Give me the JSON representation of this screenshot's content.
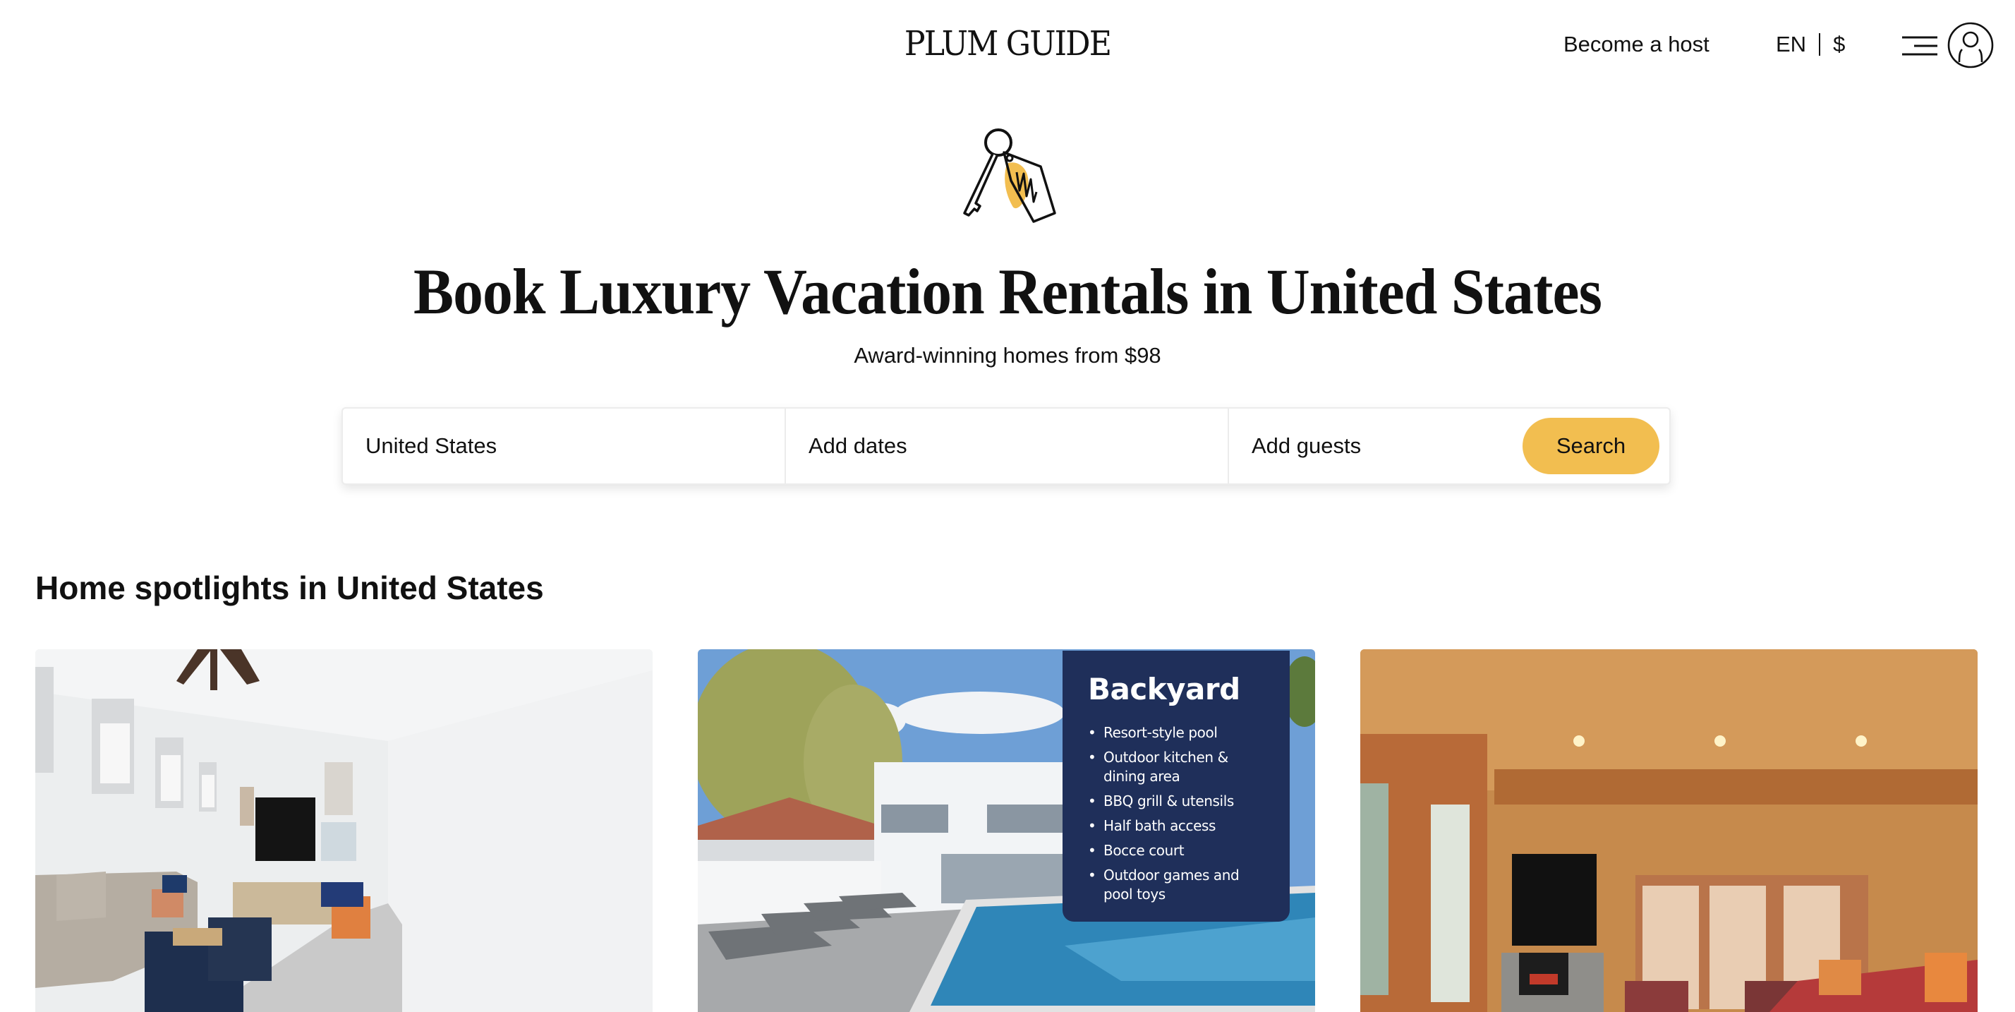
{
  "header": {
    "logo": "PLUM GUIDE",
    "become_host": "Become a host",
    "language": "EN",
    "currency": "$",
    "menu_icon": "hamburger-menu-icon",
    "account_icon": "user-avatar-icon"
  },
  "hero": {
    "illustration": "key-with-tag-icon",
    "title": "Book Luxury Vacation Rentals in United States",
    "subtitle": "Award-winning homes from $98"
  },
  "search": {
    "location_value": "United States",
    "dates_placeholder": "Add dates",
    "guests_placeholder": "Add guests",
    "button_label": "Search",
    "button_color": "#f2be50"
  },
  "spotlights": {
    "title": "Home spotlights in United States",
    "cards": [
      {
        "image": "White living room with grey sectional sofa, navy ottomans, wall-mounted TV and ceiling fan"
      },
      {
        "image": "White two-story house backyard with pool, lounge chairs and paver patio",
        "overlay": {
          "title": "Backyard",
          "items": [
            "Resort-style pool",
            "Outdoor kitchen & dining area",
            "BBQ grill & utensils",
            "Half bath access",
            "Bocce court",
            "Outdoor games and pool toys"
          ],
          "color": "#1f2f5a"
        }
      },
      {
        "image": "Log cabin living room with stone fireplace, TV, patterned armchairs and red leather sofa"
      }
    ]
  }
}
